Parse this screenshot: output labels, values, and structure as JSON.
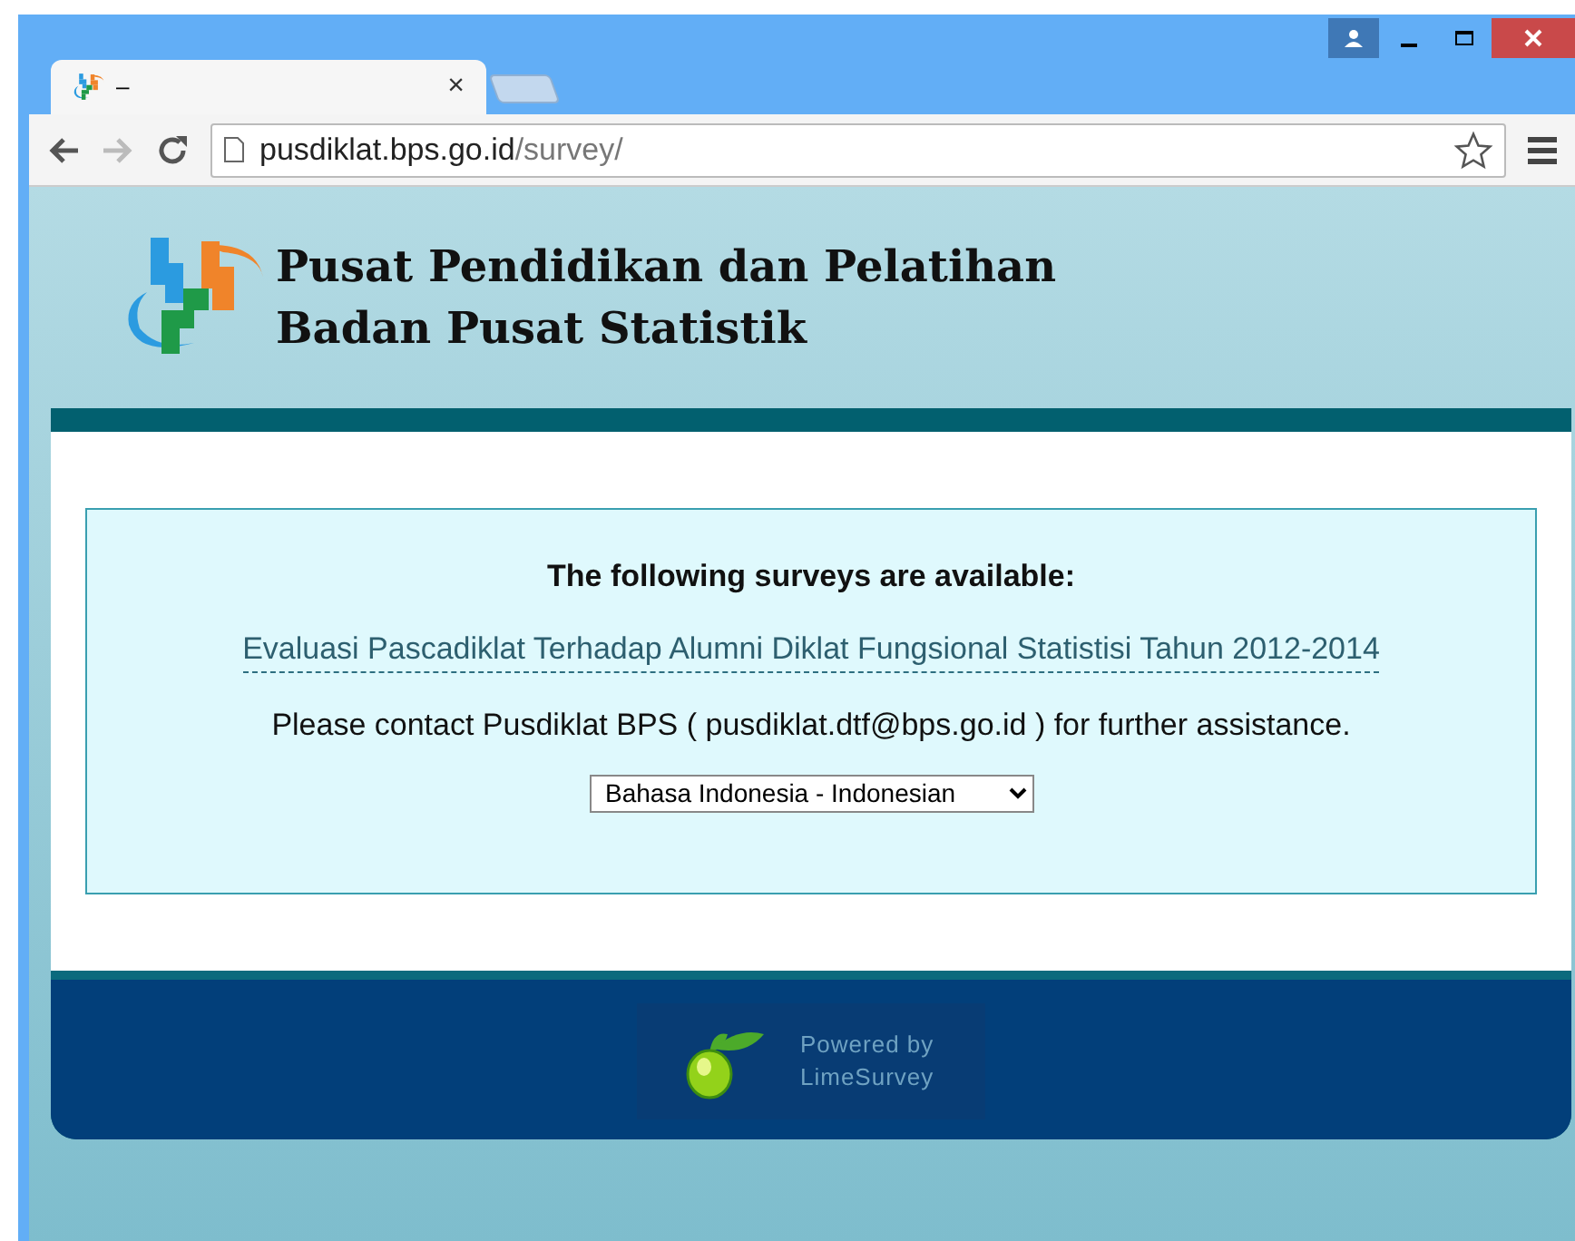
{
  "tab": {
    "title": "–",
    "close": "×"
  },
  "address_bar": {
    "host": "pusdiklat.bps.go.id",
    "path": "/survey/"
  },
  "header": {
    "title_lines": [
      "Pusat Pendidikan dan Pelatihan",
      "Badan Pusat Statistik"
    ]
  },
  "survey_box": {
    "heading": "The following surveys are available:",
    "surveys": [
      {
        "title": "Evaluasi Pascadiklat Terhadap Alumni Diklat Fungsional Statistisi Tahun 2012-2014"
      }
    ],
    "contact": "Please contact Pusdiklat BPS ( pusdiklat.dtf@bps.go.id ) for further assistance.",
    "language": "Bahasa Indonesia - Indonesian"
  },
  "footer": {
    "powered_by": [
      "Powered by",
      "LimeSurvey"
    ]
  }
}
